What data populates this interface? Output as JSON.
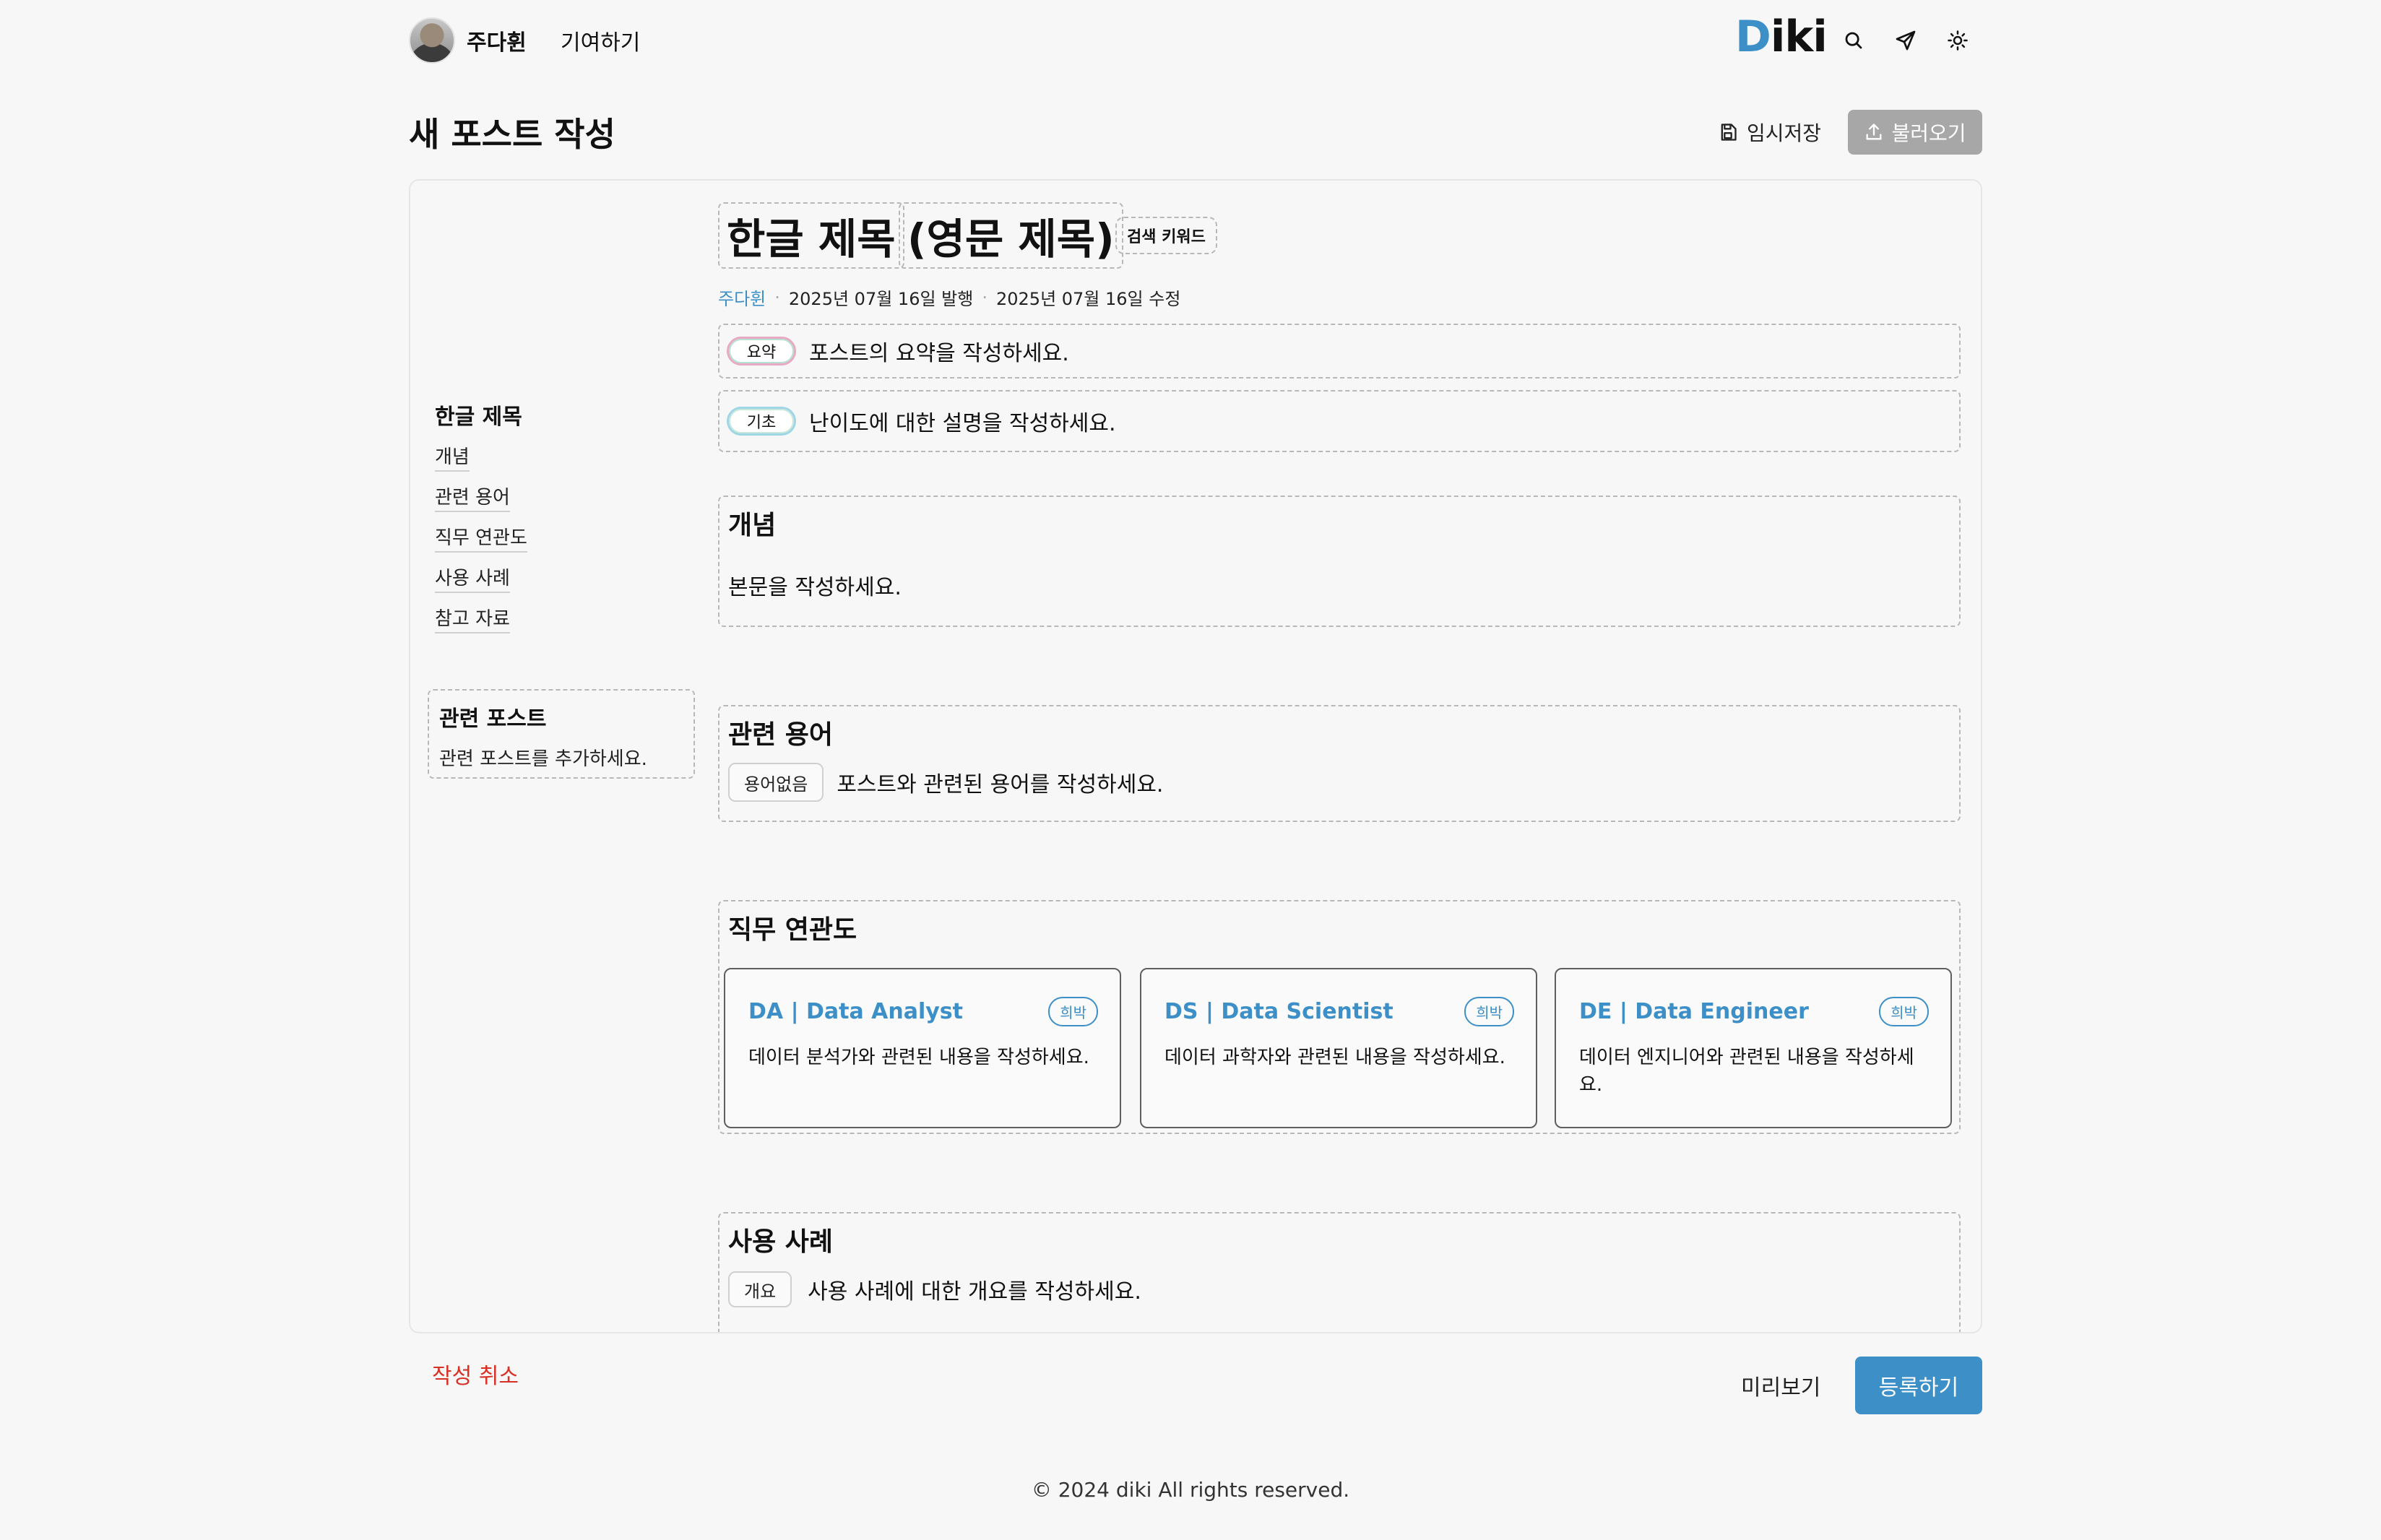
{
  "header": {
    "user_name": "주다휜",
    "contribute_label": "기여하기",
    "logo_first": "D",
    "logo_rest": "iki",
    "icons": [
      "search-icon",
      "send-icon",
      "sun-icon"
    ]
  },
  "page": {
    "title": "새 포스트 작성",
    "temp_save_label": "임시저장",
    "load_label": "불러오기"
  },
  "toc": {
    "title": "한글 제목",
    "items": [
      {
        "label": "개념"
      },
      {
        "label": "관련 용어"
      },
      {
        "label": "직무 연관도"
      },
      {
        "label": "사용 사례"
      },
      {
        "label": "참고 자료"
      }
    ]
  },
  "related_posts": {
    "title": "관련 포스트",
    "placeholder": "관련 포스트를 추가하세요."
  },
  "post": {
    "title_ko": "한글 제목",
    "title_en": "(영문 제목)",
    "search_keyword_label": "검색 키워드",
    "author": "주다휜",
    "published": "2025년 07월 16일 발행",
    "modified": "2025년 07월 16일 수정",
    "summary_pill": "요약",
    "summary_placeholder": "포스트의 요약을 작성하세요.",
    "level_pill": "기초",
    "level_placeholder": "난이도에 대한 설명을 작성하세요."
  },
  "sections": {
    "concept": {
      "title": "개념",
      "body": "본문을 작성하세요."
    },
    "terms": {
      "title": "관련 용어",
      "tag": "용어없음",
      "body": "포스트와 관련된 용어를 작성하세요."
    },
    "jobs": {
      "title": "직무 연관도",
      "cards": [
        {
          "title": "DA | Data Analyst",
          "badge": "희박",
          "desc": "데이터 분석가와 관련된 내용을 작성하세요."
        },
        {
          "title": "DS | Data Scientist",
          "badge": "희박",
          "desc": "데이터 과학자와 관련된 내용을 작성하세요."
        },
        {
          "title": "DE | Data Engineer",
          "badge": "희박",
          "desc": "데이터 엔지니어와 관련된 내용을 작성하세요."
        }
      ]
    },
    "usecases": {
      "title": "사용 사례",
      "tag": "개요",
      "body": "사용 사례에 대한 개요를 작성하세요."
    }
  },
  "actions": {
    "cancel_label": "작성 취소",
    "preview_label": "미리보기",
    "submit_label": "등록하기"
  },
  "footer": {
    "text": "© 2024 diki All rights reserved."
  },
  "colors": {
    "accent": "#3d8fc7",
    "danger": "#d93025",
    "disabled": "#a7a7a7"
  }
}
